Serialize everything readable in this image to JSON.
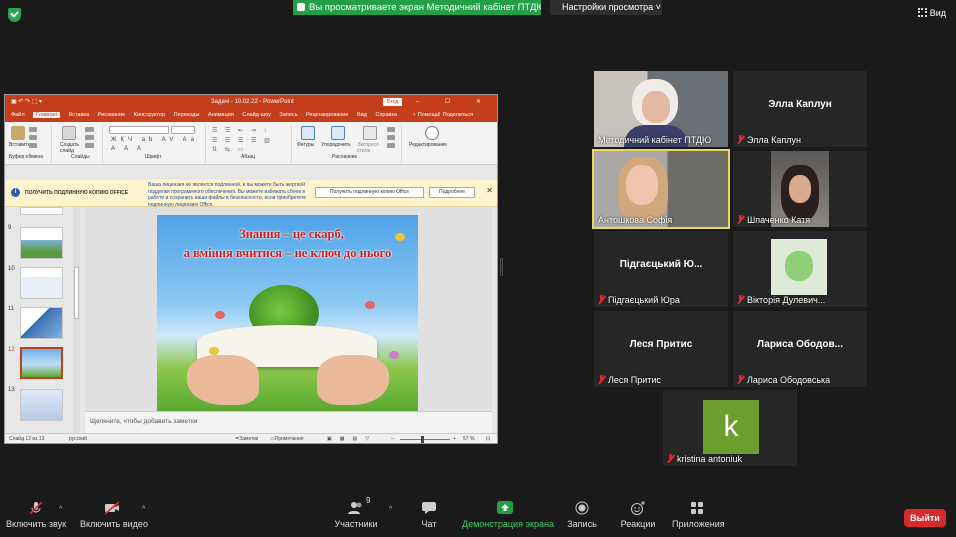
{
  "top": {
    "share_banner": "Вы просматриваете экран Методичний кабінет ПТДЮ",
    "view_settings": "Настройки просмотра ˅",
    "view_button": "Вид"
  },
  "ppt": {
    "title": "Задачі - 10.02.22 - PowerPoint",
    "login": "Вход",
    "window_controls": "▭ – ☐ ✕",
    "tabs": [
      "Файл",
      "Главная",
      "Вставка",
      "Рисование",
      "Конструктор",
      "Переходы",
      "Анимация",
      "Слайд-шоу",
      "Запись",
      "Рецензирование",
      "Вид",
      "Справка"
    ],
    "help": "Помощь",
    "share": "Поделиться",
    "ribbon": {
      "paste": "Вставить",
      "clipboard": "Буфер обмена",
      "new_slide": "Создать слайд",
      "slides": "Слайды",
      "font": "Шрифт",
      "paragraph": "Абзац",
      "shapes": "Фигуры",
      "arrange": "Упорядочить",
      "express_styles": "Экспресс-стили",
      "drawing": "Рисование",
      "editing": "Редактирование"
    },
    "infobar": {
      "heading": "ПОЛУЧИТЬ ПОДЛИННУЮ КОПИЮ OFFICE",
      "text": "Ваша лицензия не является подлинной, и вы можете быть жертвой подделки программного обеспечения. Вы можете избежать сбоев в работе и сохранить ваши файлы в безопасности, если приобретете подлинную лицензию Office.",
      "button_get": "Получить подлинную копию Office",
      "button_more": "Подробнее",
      "close": "✕"
    },
    "thumb_numbers": [
      "9",
      "10",
      "11",
      "12",
      "13"
    ],
    "slide": {
      "line1": "Знання – це скарб,",
      "line2": "а вміння вчитися – не ключ до нього"
    },
    "notes_placeholder": "Щелкните, чтобы добавить заметки",
    "status": {
      "slide_of": "Слайд 12 из 13",
      "lang": "русский",
      "notes": "Заметки",
      "comments": "Примечания",
      "zoom": "57 %"
    }
  },
  "participants": [
    {
      "name": "Методичний кабінет ПТДЮ",
      "muted": false,
      "video": true
    },
    {
      "name": "Элла Каплун",
      "center": "Элла Каплун",
      "muted": true,
      "video": false
    },
    {
      "name": "Антошкова Софія",
      "muted": false,
      "video": true,
      "active": true
    },
    {
      "name": "Шпаченко Катя",
      "muted": true,
      "video": true
    },
    {
      "name": "Підгаєцький Юра",
      "center": "Підгаєцький Ю...",
      "muted": true,
      "video": false
    },
    {
      "name": "Вікторія Дулевич...",
      "muted": true,
      "video": false
    },
    {
      "name": "Леся Притис",
      "center": "Леся Притис",
      "muted": true,
      "video": false
    },
    {
      "name": "Лариса Ободовська",
      "center": "Лариса Ободов...",
      "muted": true,
      "video": false
    },
    {
      "name": "kristina antoniuk",
      "avatar_letter": "k",
      "muted": true,
      "video": false
    }
  ],
  "toolbar": {
    "mute": "Включить звук",
    "video": "Включить видео",
    "participants": "Участники",
    "participants_count": "9",
    "chat": "Чат",
    "share": "Демонстрация экрана",
    "record": "Запись",
    "reactions": "Реакции",
    "apps": "Приложения",
    "leave": "Выйти"
  },
  "colors": {
    "zoom_green": "#23a047",
    "ppt_red": "#c43e1c",
    "leave_red": "#d62a2a",
    "active_speaker": "#e9d95a",
    "avatar_green": "#6c9d2e"
  }
}
